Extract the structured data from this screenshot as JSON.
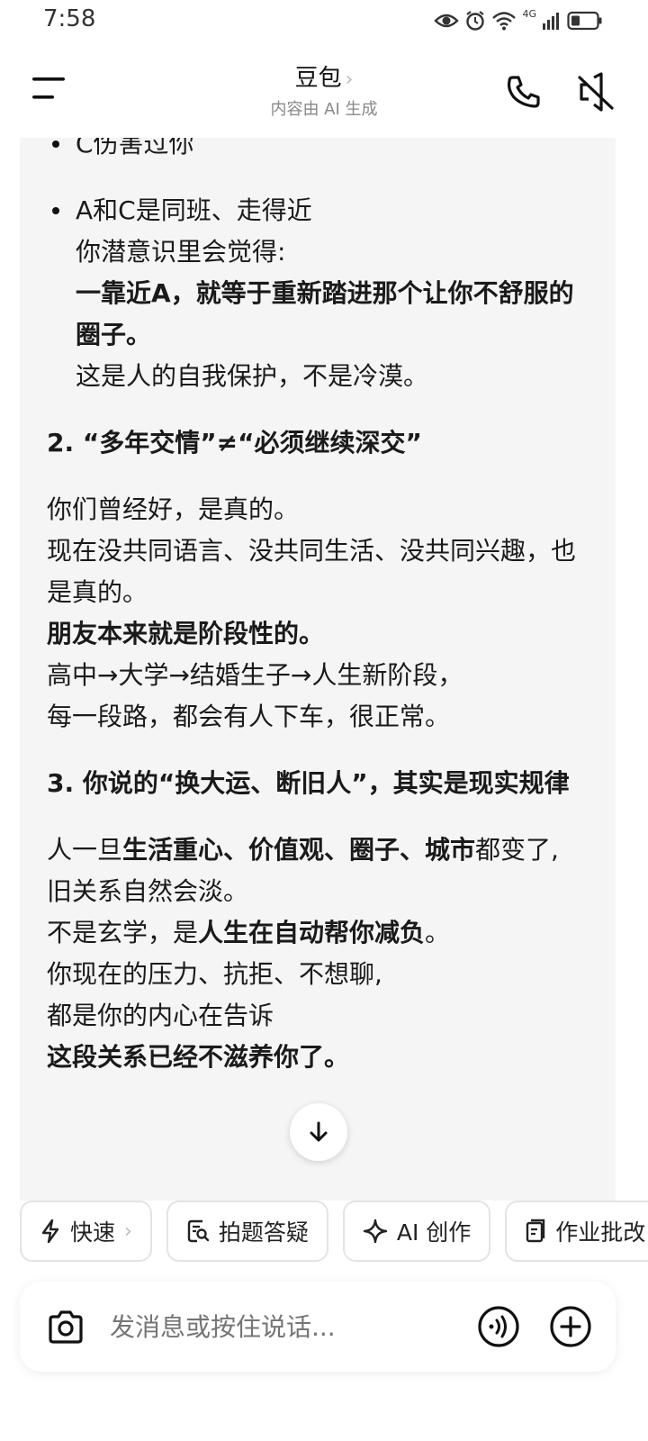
{
  "status": {
    "time": "7:58",
    "network_label": "4G",
    "icons": [
      "eye-icon",
      "alarm-icon",
      "wifi-icon",
      "signal-icon",
      "battery-icon"
    ]
  },
  "header": {
    "title": "豆包",
    "title_chevron": "›",
    "subtitle": "内容由 AI 生成"
  },
  "message": {
    "bullet1": "C伤害过你",
    "bullet2_line1": "A和C是同班、走得近",
    "bullet2_line2": "你潜意识里会觉得:",
    "bullet2_bold": "一靠近A，就等于重新踏进那个让你不舒服的圈子。",
    "bullet2_line3": "这是人的自我保护，不是冷漠。",
    "heading2": "2. “多年交情”≠“必须继续深交”",
    "p2_line1": "你们曾经好，是真的。",
    "p2_line2": "现在没共同语言、没共同生活、没共同兴趣，也是真的。",
    "p2_bold": "朋友本来就是阶段性的。",
    "p2_line3": "高中→大学→结婚生子→人生新阶段，",
    "p2_line4": "每一段路，都会有人下车，很正常。",
    "heading3": "3. 你说的“换大运、断旧人”，其实是现实规律",
    "p3_pre": "人一旦",
    "p3_bold": "生活重心、价值观、圈子、城市",
    "p3_post": "都变了,",
    "p3_line2": "旧关系自然会淡。",
    "p3_line3_pre": "不是玄学，是",
    "p3_line3_bold": "人生在自动帮你减负",
    "p3_line3_post": "。",
    "p3_line4": "你现在的压力、抗拒、不想聊,",
    "p3_line5": "都是你的内心在告诉",
    "p3_bold_last": "这段关系已经不滋养你了。"
  },
  "chips": [
    {
      "label": "快速",
      "chevron": "›"
    },
    {
      "label": "拍题答疑"
    },
    {
      "label": "AI 创作"
    },
    {
      "label": "作业批改"
    }
  ],
  "input": {
    "placeholder": "发消息或按住说话..."
  }
}
